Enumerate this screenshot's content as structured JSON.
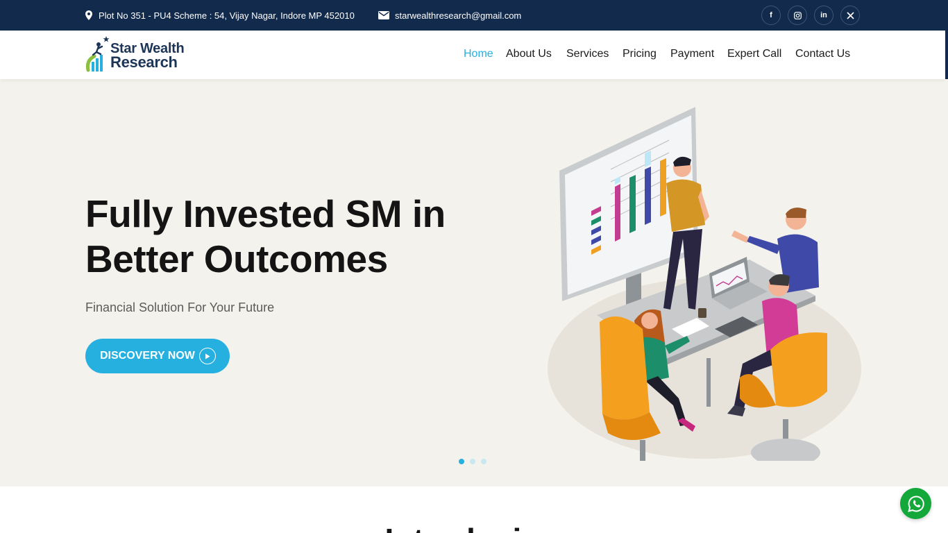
{
  "topbar": {
    "address": "Plot No 351 - PU4 Scheme : 54, Vijay Nagar, Indore MP 452010",
    "email": "starwealthresearch@gmail.com",
    "social": [
      "facebook-icon",
      "instagram-icon",
      "linkedin-icon",
      "x-twitter-icon"
    ],
    "bg_color": "#122a4c"
  },
  "logo": {
    "line1": "Star Wealth",
    "line2": "Research"
  },
  "nav": {
    "items": [
      {
        "label": "Home",
        "active": true
      },
      {
        "label": "About Us"
      },
      {
        "label": "Services"
      },
      {
        "label": "Pricing"
      },
      {
        "label": "Payment"
      },
      {
        "label": "Expert Call"
      },
      {
        "label": "Contact Us"
      }
    ],
    "active_color": "#26b0e0"
  },
  "hero": {
    "title_line1": "Fully Invested SM in",
    "title_line2": "Better Outcomes",
    "subtitle": "Financial Solution For Your Future",
    "cta": "DISCOVERY NOW",
    "slides": 3,
    "current_slide": 1,
    "bg_color": "#f4f2ec"
  },
  "intro": {
    "title": "Introducing"
  },
  "whatsapp": {
    "icon": "whatsapp-icon",
    "color": "#14a83b"
  }
}
